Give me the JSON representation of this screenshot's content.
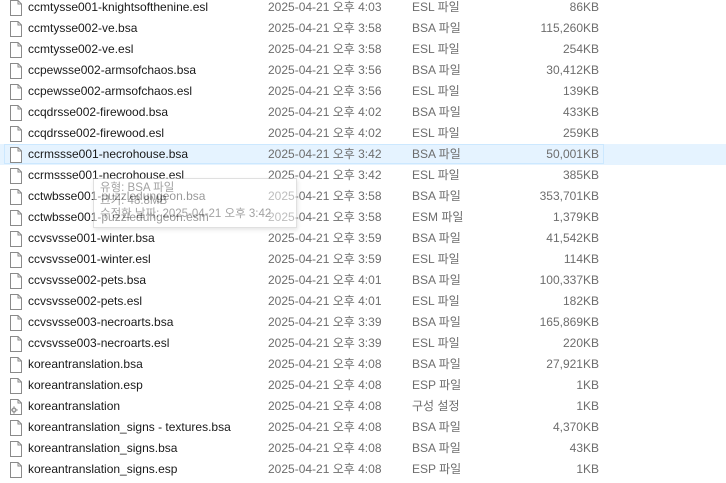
{
  "files": [
    {
      "name": "ccmtysse001-knightsofthenine.esl",
      "date": "2025-04-21 오후 4:03",
      "type": "ESL 파일",
      "size": "86KB",
      "icon": "file-icon"
    },
    {
      "name": "ccmtysse002-ve.bsa",
      "date": "2025-04-21 오후 3:58",
      "type": "BSA 파일",
      "size": "115,260KB",
      "icon": "file-icon"
    },
    {
      "name": "ccmtysse002-ve.esl",
      "date": "2025-04-21 오후 3:58",
      "type": "ESL 파일",
      "size": "254KB",
      "icon": "file-icon"
    },
    {
      "name": "ccpewsse002-armsofchaos.bsa",
      "date": "2025-04-21 오후 3:56",
      "type": "BSA 파일",
      "size": "30,412KB",
      "icon": "file-icon"
    },
    {
      "name": "ccpewsse002-armsofchaos.esl",
      "date": "2025-04-21 오후 3:56",
      "type": "ESL 파일",
      "size": "139KB",
      "icon": "file-icon"
    },
    {
      "name": "ccqdrsse002-firewood.bsa",
      "date": "2025-04-21 오후 4:02",
      "type": "BSA 파일",
      "size": "433KB",
      "icon": "file-icon"
    },
    {
      "name": "ccqdrsse002-firewood.esl",
      "date": "2025-04-21 오후 4:02",
      "type": "ESL 파일",
      "size": "259KB",
      "icon": "file-icon"
    },
    {
      "name": "ccrmssse001-necrohouse.bsa",
      "date": "2025-04-21 오후 3:42",
      "type": "BSA 파일",
      "size": "50,001KB",
      "icon": "file-icon",
      "selected": true
    },
    {
      "name": "ccrmssse001-necrohouse.esl",
      "date": "2025-04-21 오후 3:42",
      "type": "ESL 파일",
      "size": "385KB",
      "icon": "file-icon"
    },
    {
      "name": "cctwbsse001-puzzledungeon.bsa",
      "date": "2025-04-21 오후 3:58",
      "type": "BSA 파일",
      "size": "353,701KB",
      "icon": "file-icon"
    },
    {
      "name": "cctwbsse001-puzzledungeon.esm",
      "date": "2025-04-21 오후 3:58",
      "type": "ESM 파일",
      "size": "1,379KB",
      "icon": "file-icon"
    },
    {
      "name": "ccvsvsse001-winter.bsa",
      "date": "2025-04-21 오후 3:59",
      "type": "BSA 파일",
      "size": "41,542KB",
      "icon": "file-icon"
    },
    {
      "name": "ccvsvsse001-winter.esl",
      "date": "2025-04-21 오후 3:59",
      "type": "ESL 파일",
      "size": "114KB",
      "icon": "file-icon"
    },
    {
      "name": "ccvsvsse002-pets.bsa",
      "date": "2025-04-21 오후 4:01",
      "type": "BSA 파일",
      "size": "100,337KB",
      "icon": "file-icon"
    },
    {
      "name": "ccvsvsse002-pets.esl",
      "date": "2025-04-21 오후 4:01",
      "type": "ESL 파일",
      "size": "182KB",
      "icon": "file-icon"
    },
    {
      "name": "ccvsvsse003-necroarts.bsa",
      "date": "2025-04-21 오후 3:39",
      "type": "BSA 파일",
      "size": "165,869KB",
      "icon": "file-icon"
    },
    {
      "name": "ccvsvsse003-necroarts.esl",
      "date": "2025-04-21 오후 3:39",
      "type": "ESL 파일",
      "size": "220KB",
      "icon": "file-icon"
    },
    {
      "name": "koreantranslation.bsa",
      "date": "2025-04-21 오후 4:08",
      "type": "BSA 파일",
      "size": "27,921KB",
      "icon": "file-icon"
    },
    {
      "name": "koreantranslation.esp",
      "date": "2025-04-21 오후 4:08",
      "type": "ESP 파일",
      "size": "1KB",
      "icon": "file-icon"
    },
    {
      "name": "koreantranslation",
      "date": "2025-04-21 오후 4:08",
      "type": "구성 설정",
      "size": "1KB",
      "icon": "config-file-icon"
    },
    {
      "name": "koreantranslation_signs - textures.bsa",
      "date": "2025-04-21 오후 4:08",
      "type": "BSA 파일",
      "size": "4,370KB",
      "icon": "file-icon"
    },
    {
      "name": "koreantranslation_signs.bsa",
      "date": "2025-04-21 오후 4:08",
      "type": "BSA 파일",
      "size": "43KB",
      "icon": "file-icon"
    },
    {
      "name": "koreantranslation_signs.esp",
      "date": "2025-04-21 오후 4:08",
      "type": "ESP 파일",
      "size": "1KB",
      "icon": "file-icon"
    }
  ],
  "tooltip": {
    "line1": "유형: BSA 파일",
    "line2": "크기: 48.8MB",
    "line3": "수정한 날짜: 2025-04-21 오후 3:42"
  },
  "colors": {
    "selected_background": "#e5f3ff",
    "selected_border": "#cce8ff",
    "secondary_text": "#6d6d6d"
  }
}
